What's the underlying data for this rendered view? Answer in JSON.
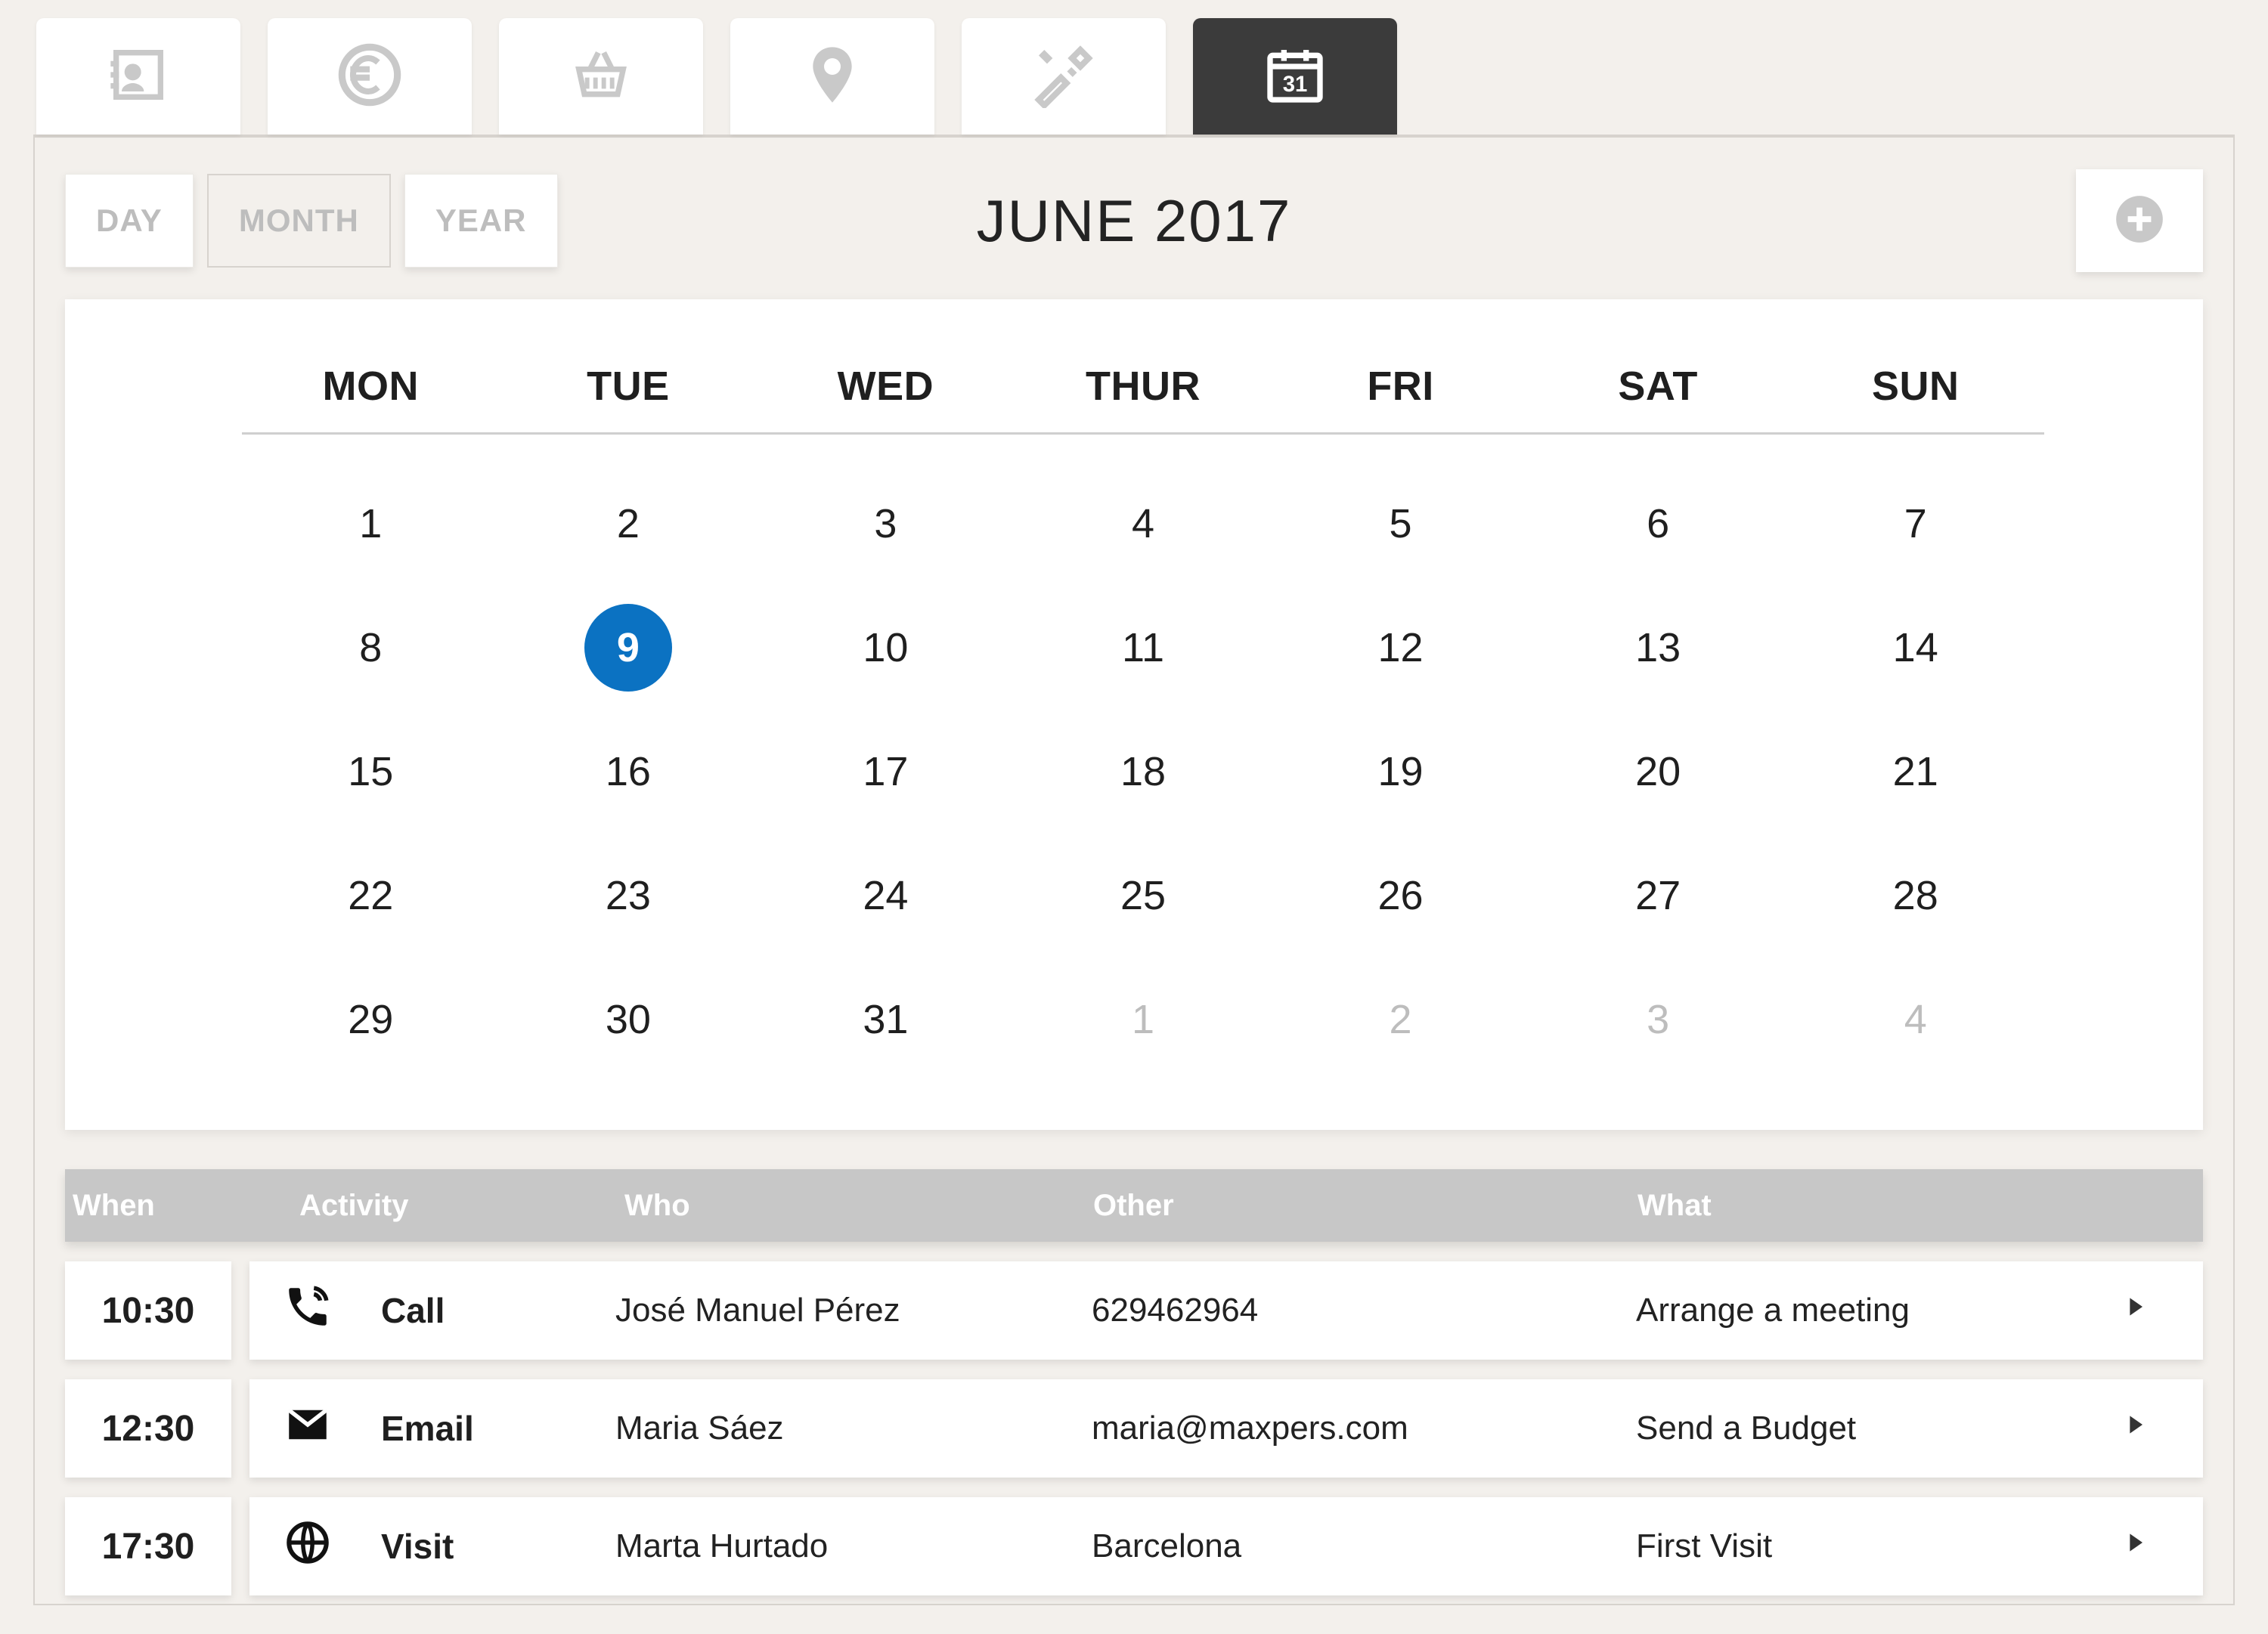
{
  "colors": {
    "accent": "#0b72c2"
  },
  "tabs": {
    "items": [
      {
        "name": "contacts-tab",
        "icon": "contact-card-icon",
        "active": false
      },
      {
        "name": "billing-tab",
        "icon": "euro-icon",
        "active": false
      },
      {
        "name": "orders-tab",
        "icon": "basket-icon",
        "active": false
      },
      {
        "name": "locations-tab",
        "icon": "pin-icon",
        "active": false
      },
      {
        "name": "tools-tab",
        "icon": "tools-icon",
        "active": false
      },
      {
        "name": "calendar-tab",
        "icon": "calendar-icon",
        "active": true
      }
    ]
  },
  "view": {
    "buttons": [
      {
        "key": "day",
        "label": "DAY",
        "selected": false
      },
      {
        "key": "month",
        "label": "MONTH",
        "selected": true
      },
      {
        "key": "year",
        "label": "YEAR",
        "selected": false
      }
    ],
    "title": "JUNE 2017"
  },
  "calendar": {
    "weekdays": [
      "MON",
      "TUE",
      "WED",
      "THUR",
      "FRI",
      "SAT",
      "SUN"
    ],
    "days": [
      {
        "n": "1",
        "other": false,
        "selected": false
      },
      {
        "n": "2",
        "other": false,
        "selected": false
      },
      {
        "n": "3",
        "other": false,
        "selected": false
      },
      {
        "n": "4",
        "other": false,
        "selected": false
      },
      {
        "n": "5",
        "other": false,
        "selected": false
      },
      {
        "n": "6",
        "other": false,
        "selected": false
      },
      {
        "n": "7",
        "other": false,
        "selected": false
      },
      {
        "n": "8",
        "other": false,
        "selected": false
      },
      {
        "n": "9",
        "other": false,
        "selected": true
      },
      {
        "n": "10",
        "other": false,
        "selected": false
      },
      {
        "n": "11",
        "other": false,
        "selected": false
      },
      {
        "n": "12",
        "other": false,
        "selected": false
      },
      {
        "n": "13",
        "other": false,
        "selected": false
      },
      {
        "n": "14",
        "other": false,
        "selected": false
      },
      {
        "n": "15",
        "other": false,
        "selected": false
      },
      {
        "n": "16",
        "other": false,
        "selected": false
      },
      {
        "n": "17",
        "other": false,
        "selected": false
      },
      {
        "n": "18",
        "other": false,
        "selected": false
      },
      {
        "n": "19",
        "other": false,
        "selected": false
      },
      {
        "n": "20",
        "other": false,
        "selected": false
      },
      {
        "n": "21",
        "other": false,
        "selected": false
      },
      {
        "n": "22",
        "other": false,
        "selected": false
      },
      {
        "n": "23",
        "other": false,
        "selected": false
      },
      {
        "n": "24",
        "other": false,
        "selected": false
      },
      {
        "n": "25",
        "other": false,
        "selected": false
      },
      {
        "n": "26",
        "other": false,
        "selected": false
      },
      {
        "n": "27",
        "other": false,
        "selected": false
      },
      {
        "n": "28",
        "other": false,
        "selected": false
      },
      {
        "n": "29",
        "other": false,
        "selected": false
      },
      {
        "n": "30",
        "other": false,
        "selected": false
      },
      {
        "n": "31",
        "other": false,
        "selected": false
      },
      {
        "n": "1",
        "other": true,
        "selected": false
      },
      {
        "n": "2",
        "other": true,
        "selected": false
      },
      {
        "n": "3",
        "other": true,
        "selected": false
      },
      {
        "n": "4",
        "other": true,
        "selected": false
      }
    ]
  },
  "events": {
    "columns": {
      "when": "When",
      "activity": "Activity",
      "who": "Who",
      "other": "Other",
      "what": "What"
    },
    "rows": [
      {
        "time": "10:30",
        "activity": "Call",
        "icon": "phone-icon",
        "who": "José Manuel Pérez",
        "other": "629462964",
        "what": "Arrange a meeting"
      },
      {
        "time": "12:30",
        "activity": "Email",
        "icon": "mail-icon",
        "who": "Maria Sáez",
        "other": "maria@maxpers.com",
        "what": "Send a Budget"
      },
      {
        "time": "17:30",
        "activity": "Visit",
        "icon": "globe-icon",
        "who": "Marta Hurtado",
        "other": "Barcelona",
        "what": "First Visit"
      }
    ]
  }
}
